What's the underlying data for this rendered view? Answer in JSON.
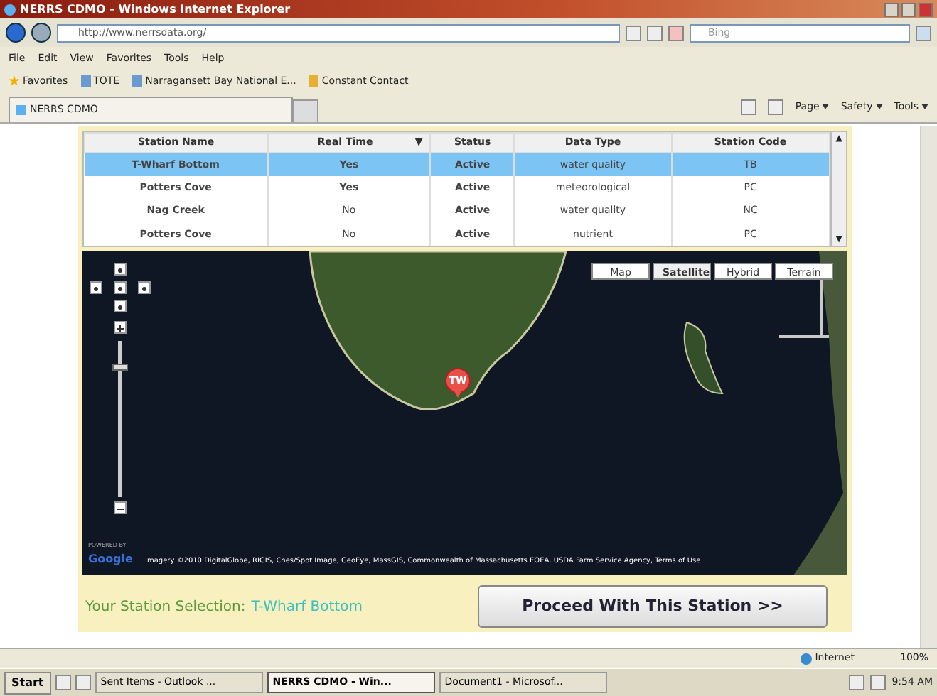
{
  "window": {
    "title": "NERRS CDMO - Windows Internet Explorer"
  },
  "address_bar": {
    "url": "http://www.nerrsdata.org/",
    "search_placeholder": "Bing"
  },
  "menu": [
    "File",
    "Edit",
    "View",
    "Favorites",
    "Tools",
    "Help"
  ],
  "favorites_bar": {
    "label": "Favorites",
    "links": [
      "TOTE",
      "Narragansett Bay National E...",
      "Constant Contact"
    ]
  },
  "tab": {
    "title": "NERRS CDMO"
  },
  "command_bar": [
    "Page",
    "Safety",
    "Tools"
  ],
  "table": {
    "columns": [
      "Station Name",
      "Real Time",
      "Status",
      "Data Type",
      "Station Code"
    ],
    "sort_mark": "▼",
    "rows": [
      {
        "name": "T-Wharf Bottom",
        "real_time": "Yes",
        "real_time_on": true,
        "status": "Active",
        "data_type": "water quality",
        "code": "TB",
        "selected": true
      },
      {
        "name": "Potters Cove",
        "real_time": "Yes",
        "real_time_on": true,
        "status": "Active",
        "data_type": "meteorological",
        "code": "PC",
        "selected": false
      },
      {
        "name": "Nag Creek",
        "real_time": "No",
        "real_time_on": false,
        "status": "Active",
        "data_type": "water quality",
        "code": "NC",
        "selected": false
      },
      {
        "name": "Potters Cove",
        "real_time": "No",
        "real_time_on": false,
        "status": "Active",
        "data_type": "nutrient",
        "code": "PC",
        "selected": false
      }
    ],
    "scroll_up": "▲",
    "scroll_down": "▼"
  },
  "map": {
    "map_types": [
      {
        "label": "Map",
        "selected": false
      },
      {
        "label": "Satellite",
        "selected": true
      },
      {
        "label": "Hybrid",
        "selected": false
      },
      {
        "label": "Terrain",
        "selected": false
      }
    ],
    "zoom": {
      "level": 0.85
    },
    "marker": "TW",
    "powered_by": "POWERED BY",
    "logo": "Google",
    "attribution": "Imagery ©2010 DigitalGlobe, RIGIS, Cnes/Spot Image, GeoEye, MassGIS, Commonwealth of Massachusetts EOEA, USDA Farm Service Agency, Terms of Use"
  },
  "selection": {
    "label": "Your Station Selection:",
    "value": "T-Wharf Bottom"
  },
  "proceed_button": "Proceed With This Station >>",
  "status_bar": {
    "zone": "Internet",
    "zoom": "100%"
  },
  "taskbar": {
    "start": "Start",
    "items": [
      {
        "label": "Sent Items - Outlook ...",
        "selected": false
      },
      {
        "label": "NERRS CDMO - Win...",
        "selected": true
      },
      {
        "label": "Document1 - Microsof...",
        "selected": false
      }
    ],
    "clock": "9:54 AM"
  }
}
